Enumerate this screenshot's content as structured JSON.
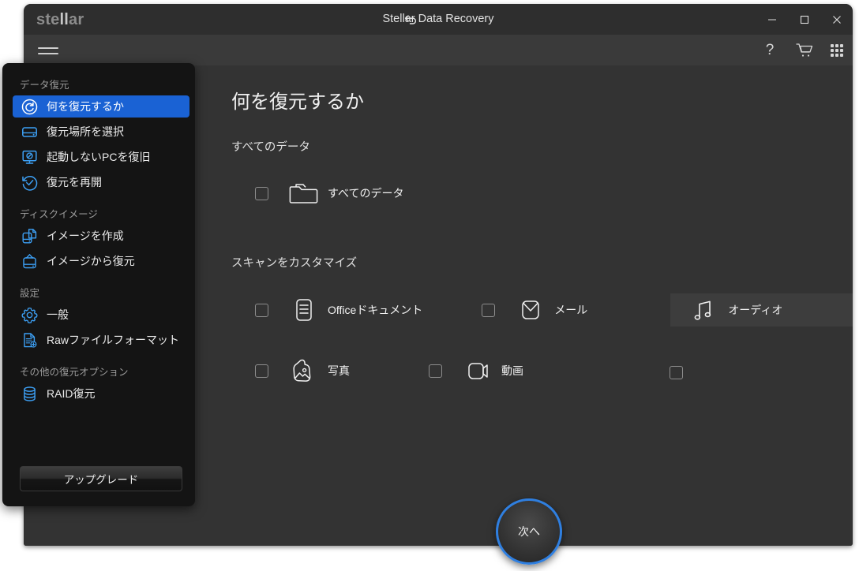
{
  "window": {
    "brand": "stellar",
    "brand_highlight": "ll",
    "title": "Stellar Data Recovery",
    "back_icon": "back-arrow-icon",
    "controls": {
      "minimize": "–",
      "maximize": "□",
      "close": "✕"
    }
  },
  "toolbar": {
    "menu_icon": "hamburger-icon",
    "help_label": "?",
    "cart_icon": "shopping-cart-icon",
    "apps_icon": "grid-apps-icon"
  },
  "sidebar": {
    "groups": [
      {
        "label": "データ復元",
        "items": [
          {
            "label": "何を復元するか",
            "icon": "refresh-circle-icon",
            "active": true
          },
          {
            "label": "復元場所を選択",
            "icon": "hard-drive-icon",
            "active": false
          },
          {
            "label": "起動しないPCを復旧",
            "icon": "monitor-disabled-icon",
            "active": false
          },
          {
            "label": "復元を再開",
            "icon": "resume-check-circle-icon",
            "active": false
          }
        ]
      },
      {
        "label": "ディスクイメージ",
        "items": [
          {
            "label": "イメージを作成",
            "icon": "create-image-icon",
            "active": false
          },
          {
            "label": "イメージから復元",
            "icon": "restore-image-icon",
            "active": false
          }
        ]
      },
      {
        "label": "設定",
        "items": [
          {
            "label": "一般",
            "icon": "gear-icon",
            "active": false
          },
          {
            "label": "Rawファイルフォーマット",
            "icon": "raw-file-icon",
            "active": false
          }
        ]
      },
      {
        "label": "その他の復元オプション",
        "items": [
          {
            "label": "RAID復元",
            "icon": "database-stack-icon",
            "active": false
          }
        ]
      }
    ],
    "upgrade_label": "アップグレード"
  },
  "main": {
    "page_title": "何を復元するか",
    "section_all_label": "すべてのデータ",
    "section_custom_label": "スキャンをカスタマイズ",
    "all_data_option": {
      "label": "すべてのデータ",
      "icon": "folder-icon",
      "checked": false
    },
    "custom_options_row1": [
      {
        "label": "Officeドキュメント",
        "icon": "document-lines-icon",
        "checked": false,
        "hovered": false
      },
      {
        "label": "メール",
        "icon": "envelope-icon",
        "checked": false,
        "hovered": false
      },
      {
        "label": "オーディオ",
        "icon": "music-note-icon",
        "checked": false,
        "hovered": true
      }
    ],
    "custom_options_row2": [
      {
        "label": "写真",
        "icon": "photo-icon",
        "checked": false,
        "hovered": false
      },
      {
        "label": "動画",
        "icon": "video-camera-icon",
        "checked": false,
        "hovered": false
      }
    ],
    "next_button_label": "次へ"
  },
  "colors": {
    "window_bg": "#333333",
    "titlebar_bg": "#2e2e2e",
    "toolbar_bg": "#3a3a3a",
    "sidebar_bg": "#141414",
    "accent_blue": "#1a62d4",
    "icon_blue": "#3da0f5",
    "next_ring": "#2f7fe0"
  }
}
